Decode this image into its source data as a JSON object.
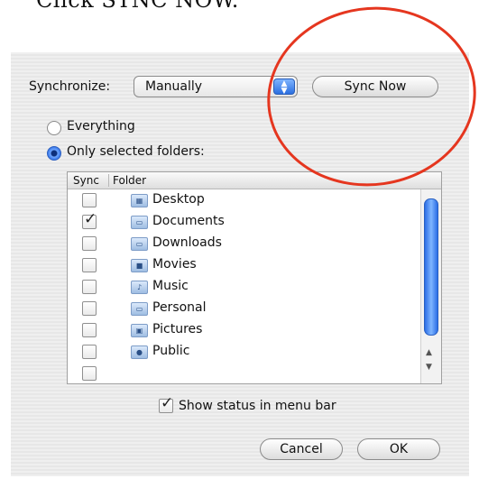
{
  "instruction": "Click SYNC NOW.",
  "dialog": {
    "synchronize_label": "Synchronize:",
    "synchronize_value": "Manually",
    "sync_now_label": "Sync Now",
    "everything_label": "Everything",
    "only_selected_label": "Only selected folders:",
    "selected_option": "Only selected folders:",
    "table": {
      "headers": [
        "Sync",
        "Folder"
      ],
      "rows": [
        {
          "name": "Desktop",
          "checked": false
        },
        {
          "name": "Documents",
          "checked": true
        },
        {
          "name": "Downloads",
          "checked": false
        },
        {
          "name": "Movies",
          "checked": false
        },
        {
          "name": "Music",
          "checked": false
        },
        {
          "name": "Personal",
          "checked": false
        },
        {
          "name": "Pictures",
          "checked": false
        },
        {
          "name": "Public",
          "checked": false
        }
      ]
    },
    "show_status_label": "Show status in menu bar",
    "show_status_checked": true,
    "cancel_label": "Cancel",
    "ok_label": "OK"
  },
  "highlight_color": "#e5361f"
}
